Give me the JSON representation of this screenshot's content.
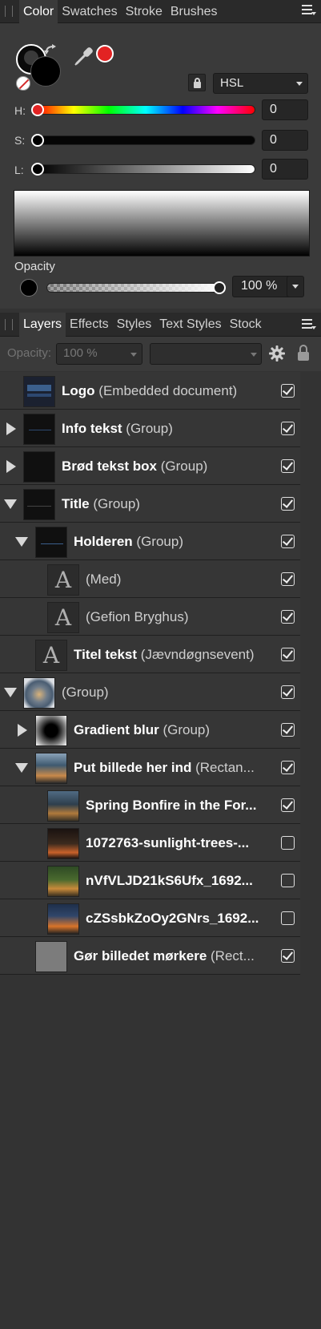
{
  "color_panel": {
    "tabs": [
      "Color",
      "Swatches",
      "Stroke",
      "Brushes"
    ],
    "active_tab": "Color",
    "model": "HSL",
    "sliders": [
      {
        "label": "H:",
        "value": "0"
      },
      {
        "label": "S:",
        "value": "0"
      },
      {
        "label": "L:",
        "value": "0"
      }
    ],
    "opacity_label": "Opacity",
    "opacity_value": "100 %",
    "colors": {
      "fill": "#000000",
      "swatch": "#e22323"
    }
  },
  "layers_panel": {
    "tabs": [
      "Layers",
      "Effects",
      "Styles",
      "Text Styles",
      "Stock"
    ],
    "active_tab": "Layers",
    "opacity_label": "Opacity:",
    "opacity_value": "100 %",
    "blend_mode": "",
    "rows": [
      {
        "name": "Logo",
        "type": "(Embedded document)",
        "checked": true
      },
      {
        "name": "Info tekst",
        "type": "(Group)",
        "checked": true
      },
      {
        "name": "Brød tekst box",
        "type": "(Group)",
        "checked": true
      },
      {
        "name": "Title",
        "type": "(Group)",
        "checked": true
      },
      {
        "name": "Holderen",
        "type": "(Group)",
        "checked": true
      },
      {
        "name": "",
        "type": "(Med)",
        "checked": true
      },
      {
        "name": "",
        "type": "(Gefion Bryghus)",
        "checked": true
      },
      {
        "name": "Titel tekst",
        "type": "(Jævndøgnsevent)",
        "checked": true
      },
      {
        "name": "",
        "type": "(Group)",
        "checked": true
      },
      {
        "name": "Gradient blur",
        "type": "(Group)",
        "checked": true
      },
      {
        "name": "Put billede her ind",
        "type": "(Rectan...",
        "checked": true
      },
      {
        "name": "Spring Bonfire in the For...",
        "type": "",
        "checked": true
      },
      {
        "name": "1072763-sunlight-trees-...",
        "type": "",
        "checked": false
      },
      {
        "name": "nVfVLJD21kS6Ufx_1692...",
        "type": "",
        "checked": false
      },
      {
        "name": "cZSsbkZoOy2GNrs_1692...",
        "type": "",
        "checked": false
      },
      {
        "name": "Gør billedet mørkere",
        "type": "(Rect...",
        "checked": true
      }
    ]
  }
}
